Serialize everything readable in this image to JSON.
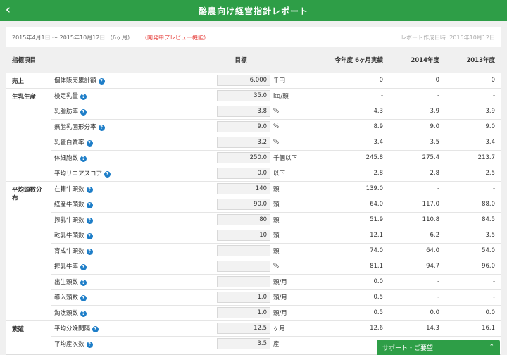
{
  "header": {
    "title": "酪農向け経営指針レポート",
    "back_icon": "‹"
  },
  "meta": {
    "period": "2015年4月1日 〜 2015年10月12日 （6ヶ月）",
    "preview": "（開発中プレビュー機能）",
    "created": "レポート作成日時: 2015年10月12日"
  },
  "columns": {
    "item": "指標項目",
    "target": "目標",
    "current": "今年度 6ヶ月実績",
    "y2014": "2014年度",
    "y2013": "2013年度"
  },
  "help_glyph": "?",
  "rows": [
    {
      "cat": "売上",
      "name": "個体販売累計額",
      "target": "6,000",
      "unit": "千円",
      "current": "0",
      "y2014": "0",
      "y2013": "0"
    },
    {
      "cat": "生乳生産",
      "name": "検定乳量",
      "target": "35.0",
      "unit": "kg/頭",
      "current": "-",
      "y2014": "-",
      "y2013": "-"
    },
    {
      "cat": "",
      "name": "乳脂肪率",
      "target": "3.8",
      "unit": "%",
      "current": "4.3",
      "y2014": "3.9",
      "y2013": "3.9"
    },
    {
      "cat": "",
      "name": "無脂乳固形分率",
      "target": "9.0",
      "unit": "%",
      "current": "8.9",
      "y2014": "9.0",
      "y2013": "9.0"
    },
    {
      "cat": "",
      "name": "乳蛋白質率",
      "target": "3.2",
      "unit": "%",
      "current": "3.4",
      "y2014": "3.5",
      "y2013": "3.4"
    },
    {
      "cat": "",
      "name": "体細胞数",
      "target": "250.0",
      "unit": "千個以下",
      "current": "245.8",
      "y2014": "275.4",
      "y2013": "213.7"
    },
    {
      "cat": "",
      "name": "平均リニアスコア",
      "target": "0.0",
      "unit": "以下",
      "current": "2.8",
      "y2014": "2.8",
      "y2013": "2.5"
    },
    {
      "cat": "平均頭数分布",
      "name": "在籍牛頭数",
      "target": "140",
      "unit": "頭",
      "current": "139.0",
      "y2014": "-",
      "y2013": "-"
    },
    {
      "cat": "",
      "name": "経産牛頭数",
      "target": "90.0",
      "unit": "頭",
      "current": "64.0",
      "y2014": "117.0",
      "y2013": "88.0"
    },
    {
      "cat": "",
      "name": "搾乳牛頭数",
      "target": "80",
      "unit": "頭",
      "current": "51.9",
      "y2014": "110.8",
      "y2013": "84.5"
    },
    {
      "cat": "",
      "name": "乾乳牛頭数",
      "target": "10",
      "unit": "頭",
      "current": "12.1",
      "y2014": "6.2",
      "y2013": "3.5"
    },
    {
      "cat": "",
      "name": "育成牛頭数",
      "target": "",
      "unit": "頭",
      "current": "74.0",
      "y2014": "64.0",
      "y2013": "54.0"
    },
    {
      "cat": "",
      "name": "搾乳牛率",
      "target": "",
      "unit": "%",
      "current": "81.1",
      "y2014": "94.7",
      "y2013": "96.0"
    },
    {
      "cat": "",
      "name": "出生頭数",
      "target": "",
      "unit": "頭/月",
      "current": "0.0",
      "y2014": "-",
      "y2013": "-"
    },
    {
      "cat": "",
      "name": "導入頭数",
      "target": "1.0",
      "unit": "頭/月",
      "current": "0.5",
      "y2014": "-",
      "y2013": "-"
    },
    {
      "cat": "",
      "name": "淘汰頭数",
      "target": "1.0",
      "unit": "頭/月",
      "current": "0.5",
      "y2014": "0.0",
      "y2013": "0.0"
    },
    {
      "cat": "繁殖",
      "name": "平均分娩間隔",
      "target": "12.5",
      "unit": "ヶ月",
      "current": "12.6",
      "y2014": "14.3",
      "y2013": "16.1"
    },
    {
      "cat": "",
      "name": "平均産次数",
      "target": "3.5",
      "unit": "産",
      "current": "",
      "y2014": "",
      "y2013": ""
    }
  ],
  "support": {
    "label": "サポート・ご要望",
    "chevron": "⌃"
  }
}
